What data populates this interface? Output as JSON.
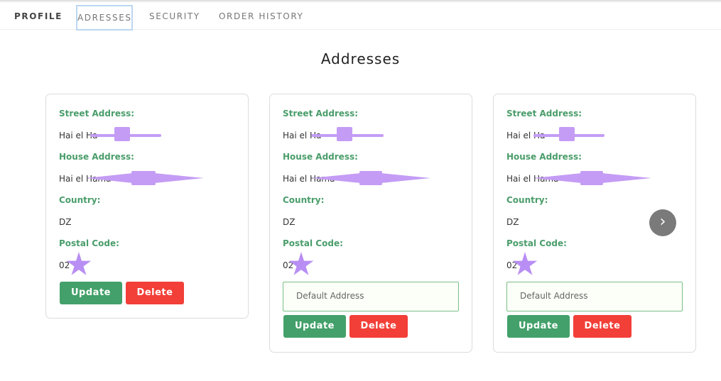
{
  "tabs": [
    {
      "label": "PROFILE"
    },
    {
      "label": "ADRESSES"
    },
    {
      "label": "SECURITY"
    },
    {
      "label": "ORDER HISTORY"
    }
  ],
  "page_title": "Addresses",
  "labels": {
    "street": "Street Address:",
    "house": "House Address:",
    "country": "Country:",
    "postal": "Postal Code:"
  },
  "cards": [
    {
      "street": "Hai el Ha",
      "house": "Hai el Hama",
      "country": "DZ",
      "postal": "02",
      "default_text": ""
    },
    {
      "street": "Hai el Ha",
      "house": "Hai el Hama",
      "country": "DZ",
      "postal": "02",
      "default_text": "Default Address"
    },
    {
      "street": "Hai el Ha",
      "house": "Hai el Hama",
      "country": "DZ",
      "postal": "02",
      "default_text": "Default Address"
    }
  ],
  "buttons": {
    "update": "Update",
    "delete": "Delete"
  },
  "icons": {
    "next": "chevron-right-icon"
  },
  "colors": {
    "accent_green": "#43a06a",
    "label_green": "#4a9d6b",
    "delete_red": "#f23f38",
    "redaction": "#c49cf5"
  }
}
